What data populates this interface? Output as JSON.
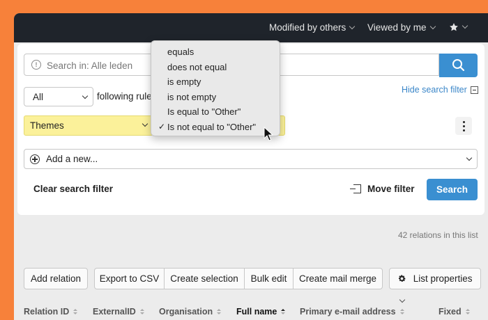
{
  "topbar": {
    "nav_modified": "Modified by others",
    "nav_viewed": "Viewed by me"
  },
  "search": {
    "placeholder": "Search in: Alle leden",
    "hide_filter": "Hide search filter"
  },
  "filter": {
    "match_value": "All",
    "following_rules": "following rule",
    "field_value": "Themes",
    "add_new": "Add a new...",
    "clear_label": "Clear search filter",
    "move_label": "Move filter",
    "search_label": "Search"
  },
  "condition_menu": {
    "options": [
      "equals",
      "does not equal",
      "is empty",
      "is not empty",
      "Is equal to \"Other\"",
      "Is not equal to \"Other\""
    ],
    "checked": "✓"
  },
  "list": {
    "count_text": "42 relations in this list"
  },
  "toolbar": {
    "add_relation": "Add relation",
    "export_csv": "Export to CSV",
    "create_selection": "Create selection",
    "bulk_edit": "Bulk edit",
    "mail_merge": "Create mail merge",
    "list_properties": "List properties"
  },
  "table": {
    "columns": [
      "Relation ID",
      "ExternalID",
      "Organisation",
      "Full name",
      "Primary e-mail address",
      "Fixed"
    ]
  },
  "colors": {
    "accent": "#3a8fd1",
    "frame": "#f7813a",
    "topbar": "#1f242b",
    "highlight": "#fbf19a"
  }
}
